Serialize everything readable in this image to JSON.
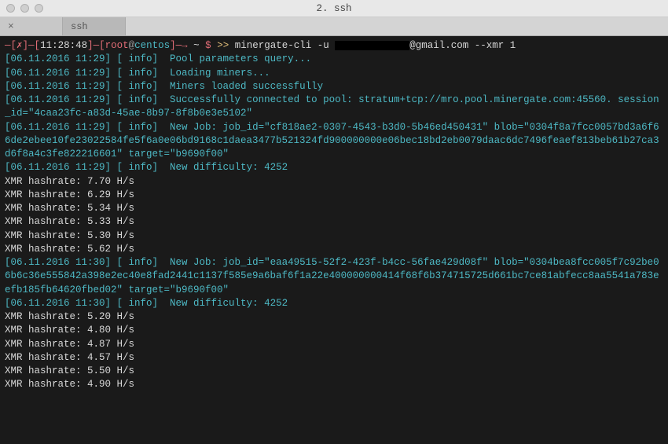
{
  "window": {
    "title": "2. ssh"
  },
  "tabs": {
    "close_glyph": "×",
    "active_label": "ssh"
  },
  "prompt": {
    "seg1_open": "—[",
    "seg1_x": "✗",
    "seg1_close": "]—[",
    "time": "11:28:48",
    "seg2_close": "]—[",
    "user": "root",
    "at": "@",
    "host": "centos",
    "seg3_close": "]—→",
    "tilde": " ~ ",
    "dollar": "$ ",
    "arrows": ">> ",
    "cmd": "minergate-cli -u ",
    "email_tail": "@gmail.com --xmr 1"
  },
  "lines": [
    {
      "ts": "[06.11.2016 11:29]",
      "tag": "[ info]",
      "msg": "Pool parameters query..."
    },
    {
      "ts": "[06.11.2016 11:29]",
      "tag": "[ info]",
      "msg": "Loading miners..."
    },
    {
      "ts": "[06.11.2016 11:29]",
      "tag": "[ info]",
      "msg": "Miners loaded successfully"
    },
    {
      "ts": "[06.11.2016 11:29]",
      "tag": "[ info]",
      "msg": "Successfully connected to pool: stratum+tcp://mro.pool.minergate.com:45560. session_id=\"4caa23fc-a83d-45ae-8b97-8f8b0e3e5102\""
    },
    {
      "ts": "[06.11.2016 11:29]",
      "tag": "[ info]",
      "msg": "New Job: job_id=\"cf818ae2-0307-4543-b3d0-5b46ed450431\" blob=\"0304f8a7fcc0057bd3a6f66de2ebee10fe23022584fe5f6a0e06bd9168c1daea3477b521324fd900000000e06bec18bd2eb0079daac6dc7496feaef813beb61b27ca3d6f8a4c3fe822216601\" target=\"b9690f00\""
    },
    {
      "ts": "[06.11.2016 11:29]",
      "tag": "[ info]",
      "msg": "New difficulty: 4252"
    }
  ],
  "hashrates1": [
    "XMR hashrate: 7.70 H/s",
    "XMR hashrate: 6.29 H/s",
    "XMR hashrate: 5.34 H/s",
    "XMR hashrate: 5.33 H/s",
    "XMR hashrate: 5.30 H/s",
    "XMR hashrate: 5.62 H/s"
  ],
  "lines2": [
    {
      "ts": "[06.11.2016 11:30]",
      "tag": "[ info]",
      "msg": "New Job: job_id=\"eaa49515-52f2-423f-b4cc-56fae429d08f\" blob=\"0304bea8fcc005f7c92be06b6c36e555842a398e2ec40e8fad2441c1137f585e9a6baf6f1a22e400000000414f68f6b374715725d661bc7ce81abfecc8aa5541a783eefb185fb64620fbed02\" target=\"b9690f00\""
    },
    {
      "ts": "[06.11.2016 11:30]",
      "tag": "[ info]",
      "msg": "New difficulty: 4252"
    }
  ],
  "hashrates2": [
    "XMR hashrate: 5.20 H/s",
    "XMR hashrate: 4.80 H/s",
    "XMR hashrate: 4.87 H/s",
    "XMR hashrate: 4.57 H/s",
    "XMR hashrate: 5.50 H/s",
    "XMR hashrate: 4.90 H/s"
  ]
}
